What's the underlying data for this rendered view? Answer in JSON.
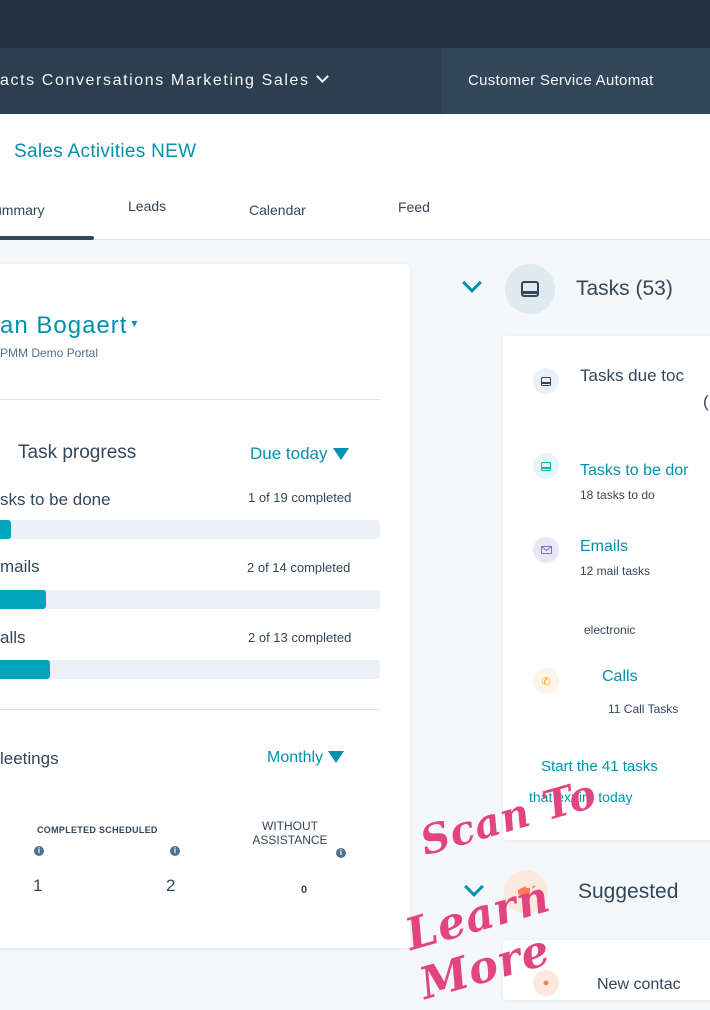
{
  "nav": {
    "main_items": "acts Conversations Marketing Sales",
    "customer_service": "Customer Service Automat"
  },
  "header": {
    "title": "Sales Activities NEW",
    "tabs": [
      {
        "label": "ummary",
        "active": true
      },
      {
        "label": "Leads",
        "active": false
      },
      {
        "label": "Calendar",
        "active": false
      },
      {
        "label": "Feed",
        "active": false
      }
    ]
  },
  "profile": {
    "name": "an Bogaert",
    "caret": "▾",
    "portal": "PMM Demo Portal"
  },
  "task_progress": {
    "title": "Task progress",
    "filter": "Due today",
    "rows": [
      {
        "label": "sks to be done",
        "count": "1 of 19 completed",
        "progress": 0.053
      },
      {
        "label": "mails",
        "count": "2 of 14 completed",
        "progress": 0.143
      },
      {
        "label": "alls",
        "count": "2 of 13 completed",
        "progress": 0.154
      }
    ]
  },
  "meetings": {
    "title": "leetings",
    "filter": "Monthly",
    "completed_scheduled_label": "COMPLETED SCHEDULED",
    "without_assistance_label": "WITHOUT ASSISTANCE",
    "completed_value": "1",
    "scheduled_value": "2",
    "without_assistance_value": "0"
  },
  "tasks_panel": {
    "title": "Tasks (53)",
    "due_today": "Tasks due toc",
    "due_today_count": "(",
    "to_be_done": "Tasks to be dor",
    "to_be_done_sub": "18 tasks to do",
    "emails": "Emails",
    "emails_sub": "12 mail tasks",
    "electronic": "electronic",
    "calls": "Calls",
    "calls_sub": "11 Call Tasks",
    "start_line1": "Start the 41 tasks",
    "start_line2": "that expire today"
  },
  "suggested": {
    "title": "Suggested",
    "new_contact": "New contac"
  },
  "promo": {
    "line1": "Scan To",
    "line2": "Learn More"
  },
  "colors": {
    "nav_dark": "#2d3e50",
    "accent": "#0091ae",
    "progress_fill": "#00a4bd",
    "promo_pink": "#e2457d"
  }
}
